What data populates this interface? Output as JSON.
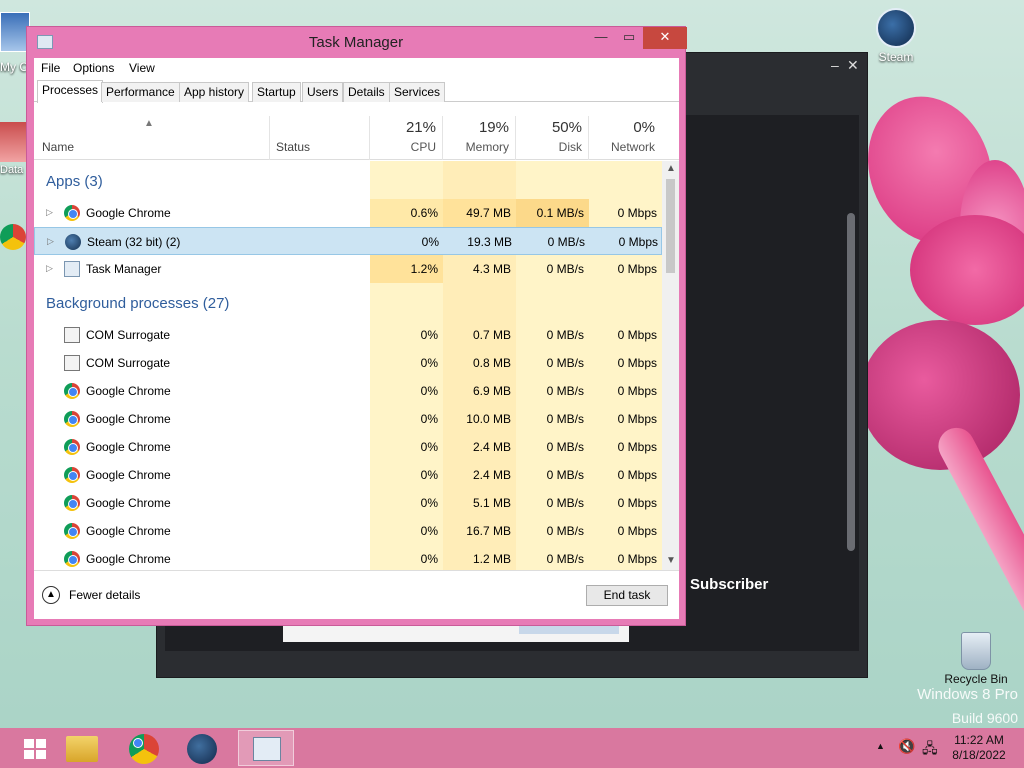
{
  "desktop": {
    "icons": {
      "steam": "Steam",
      "recycle_bin": "Recycle Bin",
      "my_computer": "My C",
      "data": "Data",
      "chrome_partial": "G\nG"
    },
    "watermark": {
      "line1": "Windows 8 Pro",
      "line2": "Build 9600"
    }
  },
  "steam_window": {
    "subscriber_text": "Subscriber",
    "minimize": "–",
    "close": "✕"
  },
  "task_manager": {
    "title": "Task Manager",
    "minimize": "—",
    "maximize": "▭",
    "close": "✕",
    "menu": [
      "File",
      "Options",
      "View"
    ],
    "tabs": [
      "Processes",
      "Performance",
      "App history",
      "Startup",
      "Users",
      "Details",
      "Services"
    ],
    "active_tab": "Processes",
    "columns": {
      "name": "Name",
      "status": "Status",
      "cpu": {
        "pct": "21%",
        "label": "CPU"
      },
      "memory": {
        "pct": "19%",
        "label": "Memory"
      },
      "disk": {
        "pct": "50%",
        "label": "Disk"
      },
      "network": {
        "pct": "0%",
        "label": "Network"
      }
    },
    "groups": {
      "apps": "Apps (3)",
      "background": "Background processes (27)"
    },
    "apps": [
      {
        "name": "Google Chrome",
        "icon": "chrome-icon",
        "cpu": "0.6%",
        "memory": "49.7 MB",
        "disk": "0.1 MB/s",
        "network": "0 Mbps"
      },
      {
        "name": "Steam (32 bit) (2)",
        "icon": "steam-icon",
        "cpu": "0%",
        "memory": "19.3 MB",
        "disk": "0 MB/s",
        "network": "0 Mbps"
      },
      {
        "name": "Task Manager",
        "icon": "task-manager-icon",
        "cpu": "1.2%",
        "memory": "4.3 MB",
        "disk": "0 MB/s",
        "network": "0 Mbps"
      }
    ],
    "background": [
      {
        "name": "COM Surrogate",
        "icon": "com-surrogate-icon",
        "cpu": "0%",
        "memory": "0.7 MB",
        "disk": "0 MB/s",
        "network": "0 Mbps"
      },
      {
        "name": "COM Surrogate",
        "icon": "com-surrogate-icon",
        "cpu": "0%",
        "memory": "0.8 MB",
        "disk": "0 MB/s",
        "network": "0 Mbps"
      },
      {
        "name": "Google Chrome",
        "icon": "chrome-icon",
        "cpu": "0%",
        "memory": "6.9 MB",
        "disk": "0 MB/s",
        "network": "0 Mbps"
      },
      {
        "name": "Google Chrome",
        "icon": "chrome-icon",
        "cpu": "0%",
        "memory": "10.0 MB",
        "disk": "0 MB/s",
        "network": "0 Mbps"
      },
      {
        "name": "Google Chrome",
        "icon": "chrome-icon",
        "cpu": "0%",
        "memory": "2.4 MB",
        "disk": "0 MB/s",
        "network": "0 Mbps"
      },
      {
        "name": "Google Chrome",
        "icon": "chrome-icon",
        "cpu": "0%",
        "memory": "2.4 MB",
        "disk": "0 MB/s",
        "network": "0 Mbps"
      },
      {
        "name": "Google Chrome",
        "icon": "chrome-icon",
        "cpu": "0%",
        "memory": "5.1 MB",
        "disk": "0 MB/s",
        "network": "0 Mbps"
      },
      {
        "name": "Google Chrome",
        "icon": "chrome-icon",
        "cpu": "0%",
        "memory": "16.7 MB",
        "disk": "0 MB/s",
        "network": "0 Mbps"
      },
      {
        "name": "Google Chrome",
        "icon": "chrome-icon",
        "cpu": "0%",
        "memory": "1.2 MB",
        "disk": "0 MB/s",
        "network": "0 Mbps"
      }
    ],
    "footer": {
      "fewer_details": "Fewer details",
      "end_task": "End task"
    },
    "colors": {
      "frame": "#e77bb6",
      "heat_light": "#fff4c8",
      "heat_mid": "#ffe9a8",
      "heat_strong": "#fcd98a",
      "selected": "#cce4f3",
      "group_text": "#2f5d9c"
    }
  },
  "taskbar": {
    "items": [
      "start-icon",
      "file-explorer-icon",
      "chrome-icon",
      "steam-icon",
      "task-manager-icon"
    ],
    "tray": {
      "show_hidden": "▲",
      "time": "11:22 AM",
      "date": "8/18/2022"
    }
  }
}
